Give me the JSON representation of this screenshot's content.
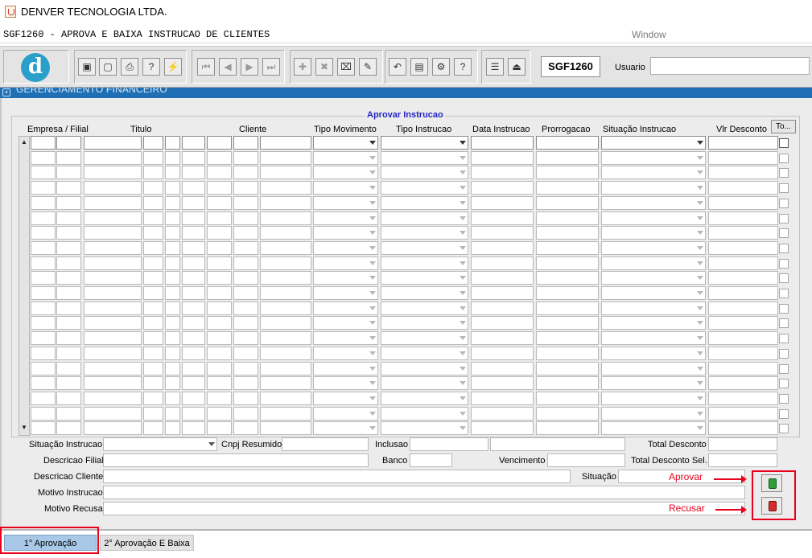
{
  "window": {
    "title": "DENVER TECNOLOGIA LTDA."
  },
  "menubar": {
    "form_title": "SGF1260 - APROVA E BAIXA INSTRUCAO DE CLIENTES",
    "window_menu": "Window"
  },
  "toolbar": {
    "logo_letter": "d",
    "form_code": "SGF1260",
    "usuario_label": "Usuario",
    "usuario_value": "",
    "buttons": [
      {
        "name": "save-button",
        "glyph": "▣"
      },
      {
        "name": "window-button",
        "glyph": "▢"
      },
      {
        "name": "print-button",
        "glyph": "⎙"
      },
      {
        "name": "query-help-button",
        "glyph": "?"
      },
      {
        "name": "execute-query-button",
        "glyph": "⚡"
      },
      {
        "name": "first-record-button",
        "glyph": "⏮"
      },
      {
        "name": "previous-record-button",
        "glyph": "◀"
      },
      {
        "name": "next-record-button",
        "glyph": "▶"
      },
      {
        "name": "last-record-button",
        "glyph": "⏭"
      },
      {
        "name": "insert-record-button",
        "glyph": "✚"
      },
      {
        "name": "delete-record-button",
        "glyph": "✖"
      },
      {
        "name": "clear-record-button",
        "glyph": "⌧"
      },
      {
        "name": "edit-button",
        "glyph": "✎"
      },
      {
        "name": "undo-button",
        "glyph": "↶"
      },
      {
        "name": "list-values-button",
        "glyph": "▤"
      },
      {
        "name": "settings-button",
        "glyph": "⚙"
      },
      {
        "name": "help-button",
        "glyph": "?"
      },
      {
        "name": "menu-button",
        "glyph": "☰"
      },
      {
        "name": "exit-button",
        "glyph": "⏏"
      }
    ]
  },
  "header": {
    "caption": "GERENCIAMENTO FINANCEIRO"
  },
  "group": {
    "title": "Aprovar Instrucao",
    "select_all_label": "To...",
    "columns": [
      {
        "label": "Empresa / Filial"
      },
      {
        "label": "Titulo"
      },
      {
        "label": "Cliente"
      },
      {
        "label": "Tipo Movimento"
      },
      {
        "label": "Tipo Instrucao"
      },
      {
        "label": "Data Instrucao"
      },
      {
        "label": "Prorrogacao"
      },
      {
        "label": "Situação Instrucao"
      },
      {
        "label": "Vlr Desconto"
      }
    ],
    "row_count": 20
  },
  "details": {
    "situacao_instrucao_label": "Situação Instrucao",
    "cnpj_resumido_label": "Cnpj Resumido",
    "inclusao_label": "Inclusao",
    "total_desconto_label": "Total Desconto",
    "descricao_filial_label": "Descricao Filial",
    "banco_label": "Banco",
    "vencimento_label": "Vencimento",
    "total_desconto_sel_label": "Total Desconto Sel.",
    "descricao_cliente_label": "Descricao Cliente",
    "situacao_label": "Situação",
    "motivo_instrucao_label": "Motivo Instrucao",
    "motivo_recusa_label": "Motivo Recusa"
  },
  "annotations": {
    "aprovar": "Aprovar",
    "recusar": "Recusar",
    "color": "#e8001c"
  },
  "tabs": [
    {
      "label": "1° Aprovação",
      "active": true
    },
    {
      "label": "2° Aprovação E Baixa",
      "active": false
    }
  ],
  "colors": {
    "header_band": "#1f6fb4",
    "group_title": "#2323c8",
    "active_tab": "#a9c8e8",
    "logo": "#2a9fc9"
  }
}
